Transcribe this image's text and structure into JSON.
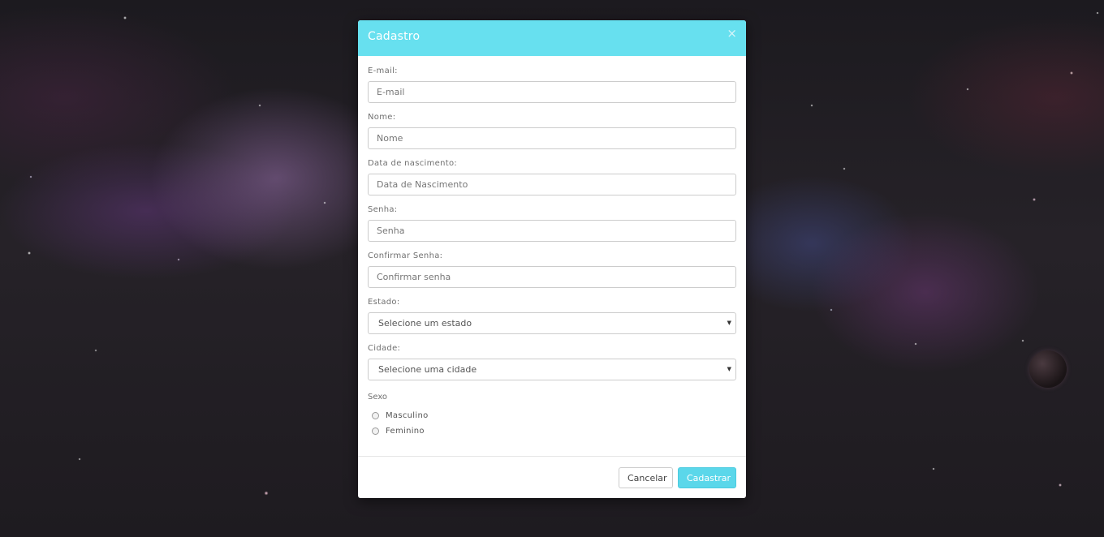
{
  "modal": {
    "title": "Cadastro",
    "close_symbol": "×"
  },
  "form": {
    "email": {
      "label": "E-mail:",
      "placeholder": "E-mail"
    },
    "nome": {
      "label": "Nome:",
      "placeholder": "Nome"
    },
    "nascimento": {
      "label": "Data de nascimento:",
      "placeholder": "Data de Nascimento"
    },
    "senha": {
      "label": "Senha:",
      "placeholder": "Senha"
    },
    "confirmar": {
      "label": "Confirmar Senha:",
      "placeholder": "Confirmar senha"
    },
    "estado": {
      "label": "Estado:",
      "selected": "Selecione um estado",
      "arrow": "▼"
    },
    "cidade": {
      "label": "Cidade:",
      "selected": "Selecione uma cidade",
      "arrow": "▼"
    },
    "sexo": {
      "label": "Sexo",
      "options": [
        "Masculino",
        "Feminino"
      ]
    }
  },
  "footer": {
    "cancel_label": "Cancelar",
    "submit_label": "Cadastrar"
  },
  "colors": {
    "header": "#67e0ef",
    "primary_button": "#5bd7ea"
  },
  "icons": {
    "close": "close-icon",
    "select_arrow": "chevron-down-icon",
    "radio": "radio-icon"
  }
}
